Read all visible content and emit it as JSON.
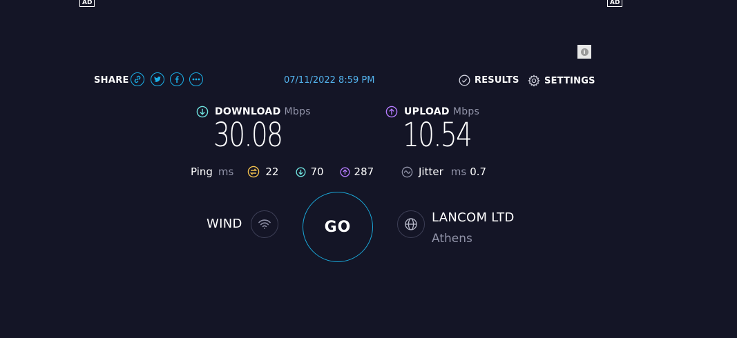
{
  "ads": {
    "left": "AD",
    "right": "AD"
  },
  "info_icon": "i",
  "share": {
    "label": "SHARE",
    "icons": [
      "link-icon",
      "twitter-icon",
      "facebook-icon",
      "more-icon"
    ]
  },
  "date": "07/11/2022 8:59 PM",
  "results_label": "RESULTS",
  "settings_label": "SETTINGS",
  "download": {
    "label": "DOWNLOAD",
    "unit": "Mbps",
    "value": "30.08"
  },
  "upload": {
    "label": "UPLOAD",
    "unit": "Mbps",
    "value": "10.54"
  },
  "ping": {
    "label": "Ping",
    "unit": "ms",
    "idle": "22",
    "down": "70",
    "up": "287"
  },
  "jitter": {
    "label": "Jitter",
    "unit": "ms",
    "value": "0.7"
  },
  "isp": {
    "name": "WIND"
  },
  "go_label": "GO",
  "server": {
    "name": "LANCOM LTD",
    "location": "Athens"
  },
  "colors": {
    "background": "#141526",
    "accent": "#1ab0e8",
    "download": "#6fe3df",
    "upload": "#b57bff",
    "ping_idle": "#f2c14e"
  }
}
